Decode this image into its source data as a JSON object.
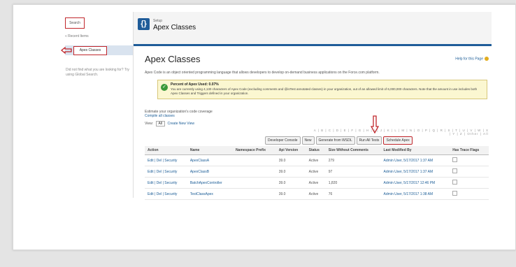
{
  "sidebar": {
    "search_label": "Search",
    "recent_label": "« Recent Items",
    "active_item": "Apex Classes",
    "help_text": "Did not find what you are looking for? Try using Global Search."
  },
  "header": {
    "breadcrumb": "Setup",
    "title": "Apex Classes"
  },
  "page": {
    "title": "Apex Classes",
    "help_link": "Help for this Page",
    "description": "Apex Code is an object oriented programming language that allows developers to develop on-demand business applications on the Force.com platform."
  },
  "message": {
    "title": "Percent of Apex Used: 0.07%",
    "body": "You are currently using 4,130 characters of Apex Code (excluding comments and @isTest annotated classes) in your organization, out of an allowed limit of 6,000,000 characters. Note that the amount in use includes both Apex Classes and Triggers defined in your organization."
  },
  "coverage": {
    "percent_text": "Estimate your organization's code coverage",
    "compile_link": "Compile all classes"
  },
  "view": {
    "label": "View:",
    "selected": "All",
    "create_link": "Create New View"
  },
  "alpha_bar": "A | B | C | D | E | F | G | H | I | J | K | L | M | N | O | P | Q | R | S | T | U | V | W | X | Y | Z | Other | All",
  "buttons": [
    "Developer Console",
    "New",
    "Generate from WSDL",
    "Run All Tests",
    "Schedule Apex"
  ],
  "table": {
    "headers": [
      "Action",
      "Name",
      "Namespace Prefix",
      "Api Version",
      "Status",
      "Size Without Comments",
      "Last Modified By",
      "Has Trace Flags"
    ],
    "rows": [
      {
        "action": "Edit | Del | Security",
        "name": "ApexClassA",
        "namespace": "",
        "api": "39.0",
        "status": "Active",
        "size": "279",
        "modified": "Admin User, 5/17/2017 1:37 AM"
      },
      {
        "action": "Edit | Del | Security",
        "name": "ApexClassB",
        "namespace": "",
        "api": "39.0",
        "status": "Active",
        "size": "97",
        "modified": "Admin User, 5/17/2017 1:37 AM"
      },
      {
        "action": "Edit | Del | Security",
        "name": "BatchApexController",
        "namespace": "",
        "api": "39.0",
        "status": "Active",
        "size": "1,820",
        "modified": "Admin User, 5/17/2017 12:46 PM"
      },
      {
        "action": "Edit | Del | Security",
        "name": "TestClassApex",
        "namespace": "",
        "api": "39.0",
        "status": "Active",
        "size": "76",
        "modified": "Admin User, 5/17/2017 1:38 AM"
      }
    ]
  },
  "colors": {
    "accent": "#1f5c99",
    "highlight": "#c0262b",
    "message_bg": "#fbf7d1"
  }
}
